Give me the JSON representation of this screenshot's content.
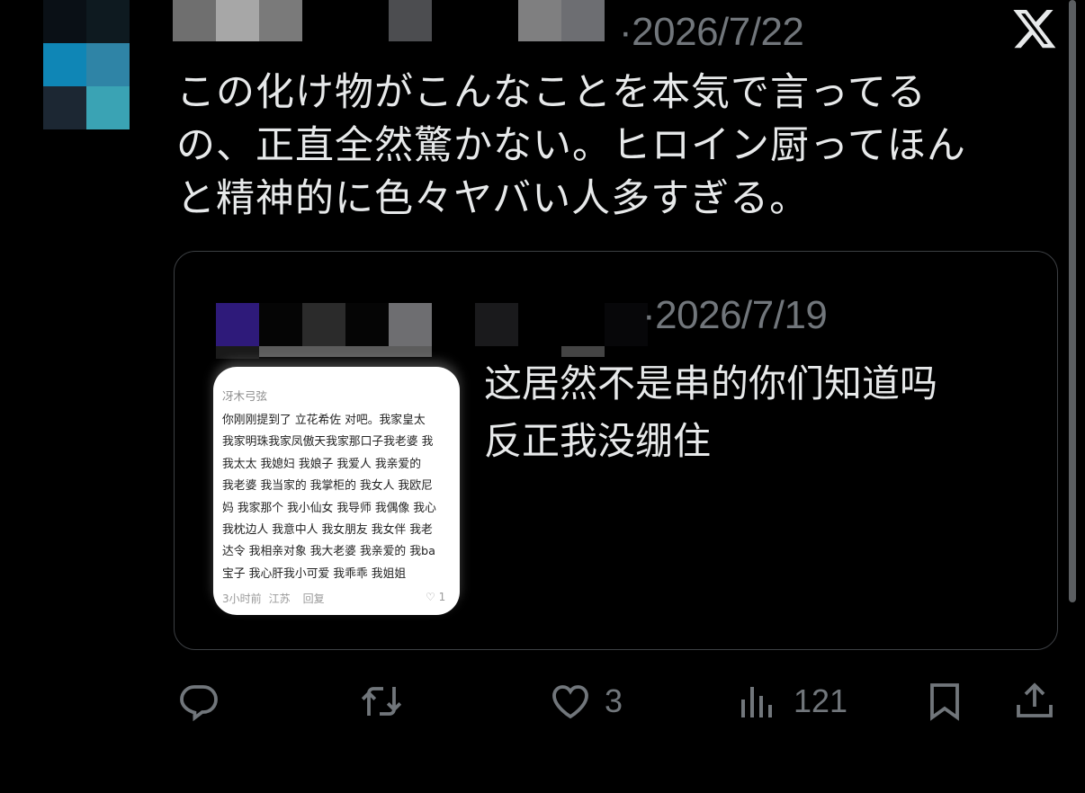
{
  "tweet": {
    "date": "·2026/7/22",
    "text": "この化け物がこんなことを本気で言ってる\nの、正直全然驚かない。ヒロイン厨ってほん\nと精神的に色々ヤバい人多すぎる。"
  },
  "quoted_tweet": {
    "date": "·2026/7/19",
    "text": "这居然不是串的你们知道吗\n反正我没绷住",
    "image": {
      "author": "冴木弓弦",
      "lines": [
        "你刚刚提到了 立花希佐 对吧。我家皇太",
        "我家明珠我家凤傲天我家那口子我老婆 我",
        "我太太 我媳妇 我娘子 我爱人 我亲爱的",
        "我老婆 我当家的 我掌柜的 我女人 我欧尼",
        "妈 我家那个 我小仙女 我导师 我偶像 我心",
        "我枕边人 我意中人 我女朋友 我女伴 我老",
        "达令 我相亲对象 我大老婆 我亲爱的 我ba",
        "宝子 我心肝我小可爱 我乖乖 我姐姐"
      ],
      "time": "3小时前",
      "location": "江苏",
      "reply": "回复",
      "likes": "1"
    }
  },
  "actions": {
    "reply_icon": "reply-icon",
    "retweet_icon": "retweet-icon",
    "like_icon": "heart-icon",
    "like_count": "3",
    "views_icon": "views-icon",
    "views_count": "121",
    "bookmark_icon": "bookmark-icon",
    "share_icon": "share-icon"
  },
  "colors": {
    "background": "#000000",
    "text": "#e7e9ea",
    "muted": "#71767b",
    "border": "#3c3f43"
  }
}
